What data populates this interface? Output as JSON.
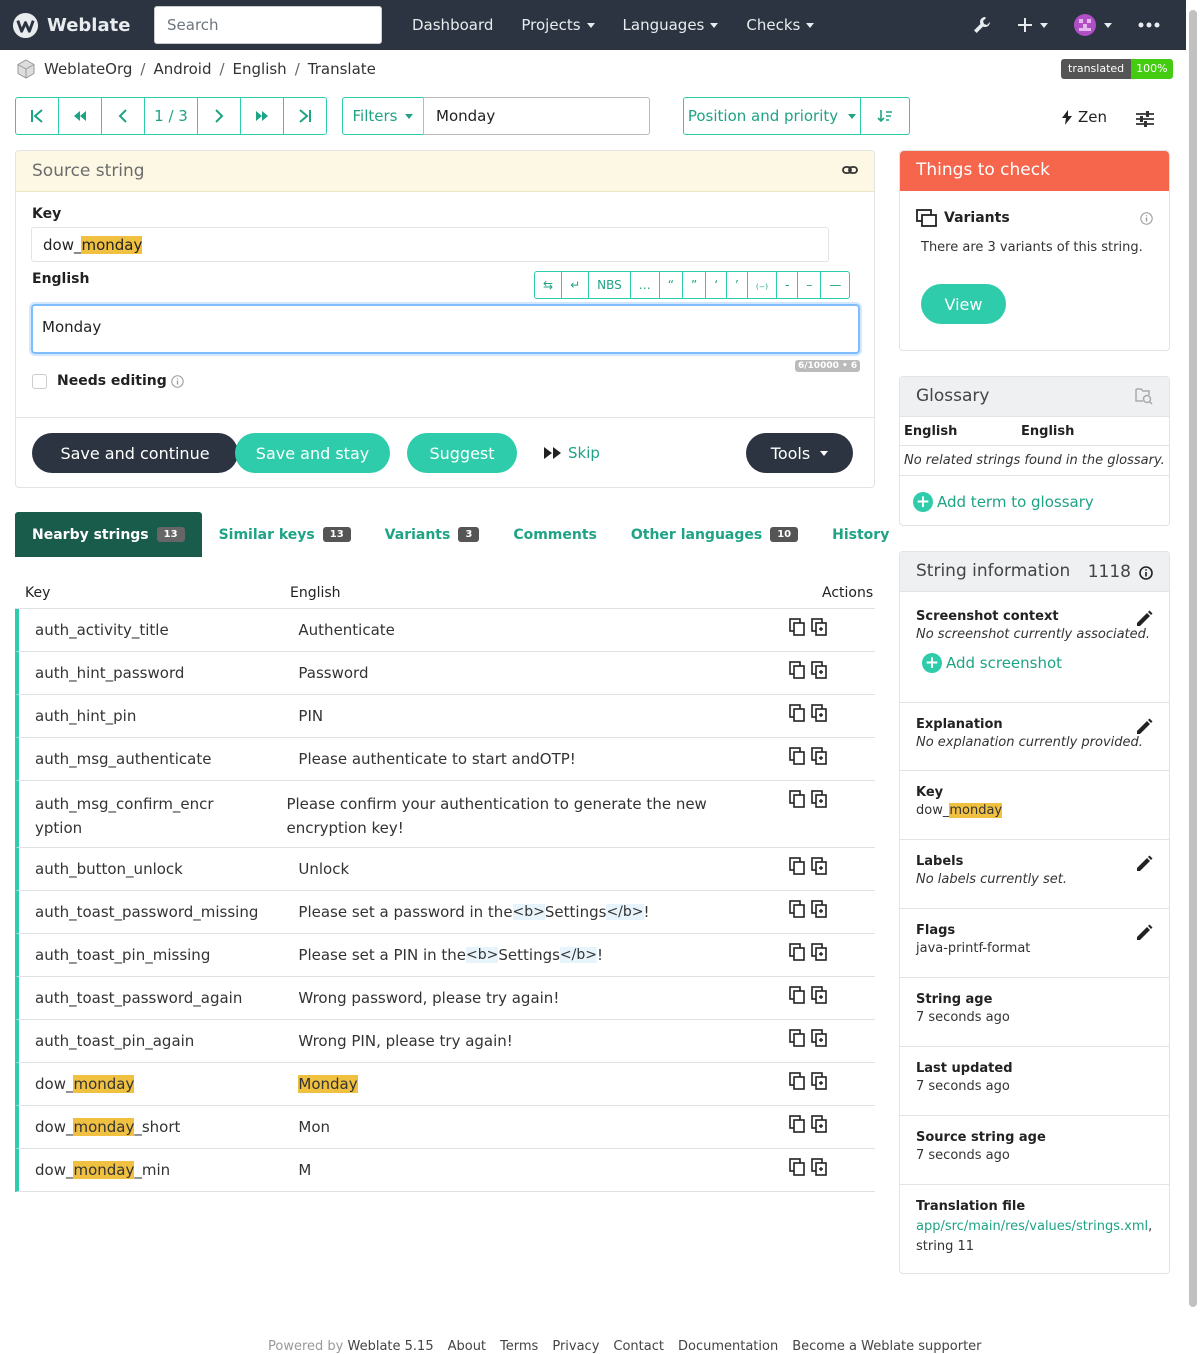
{
  "nav": {
    "brand": "Weblate",
    "search_placeholder": "Search",
    "links": [
      "Dashboard",
      "Projects",
      "Languages",
      "Checks"
    ]
  },
  "breadcrumb": [
    "WeblateOrg",
    "Android",
    "English",
    "Translate"
  ],
  "status_badge": {
    "label": "translated",
    "value": "100%"
  },
  "toolbar": {
    "position": "1 / 3",
    "filters_label": "Filters",
    "query_value": "Monday",
    "sort_label": "Position and priority",
    "zen_label": "Zen"
  },
  "source": {
    "header": "Source string",
    "key_label": "Key",
    "key_prefix": "dow_",
    "key_highlight": "monday",
    "lang_label": "English",
    "char_buttons": [
      "⇆",
      "↵",
      "NBS",
      "…",
      "“",
      "”",
      "‘",
      "’",
      "₍₋₎",
      "‐",
      "–",
      "—"
    ],
    "editor_value": "Monday",
    "counter": "6/10000 • 6",
    "needs_editing_label": "Needs editing",
    "buttons": {
      "save_continue": "Save and continue",
      "save_stay": "Save and stay",
      "suggest": "Suggest",
      "skip": "Skip",
      "tools": "Tools"
    }
  },
  "tabs": [
    {
      "label": "Nearby strings",
      "count": "13"
    },
    {
      "label": "Similar keys",
      "count": "13"
    },
    {
      "label": "Variants",
      "count": "3"
    },
    {
      "label": "Comments",
      "count": ""
    },
    {
      "label": "Other languages",
      "count": "10"
    },
    {
      "label": "History",
      "count": ""
    }
  ],
  "table": {
    "headers": [
      "Key",
      "English",
      "Actions"
    ],
    "rows": [
      {
        "k1": "auth_activity_title",
        "k2": "",
        "k3": "",
        "e1": "Authenticate",
        "e2": "",
        "e3": "",
        "e4": "",
        "e5": ""
      },
      {
        "k1": "auth_hint_password",
        "k2": "",
        "k3": "",
        "e1": "Password",
        "e2": "",
        "e3": "",
        "e4": "",
        "e5": ""
      },
      {
        "k1": "auth_hint_pin",
        "k2": "",
        "k3": "",
        "e1": "PIN",
        "e2": "",
        "e3": "",
        "e4": "",
        "e5": ""
      },
      {
        "k1": "auth_msg_authenticate",
        "k2": "",
        "k3": "",
        "e1": "Please authenticate to start andOTP!",
        "e2": "",
        "e3": "",
        "e4": "",
        "e5": ""
      },
      {
        "k1": "auth_msg_confirm_encryption",
        "k2": "",
        "k3": "",
        "e1": "Please confirm your authentication to generate the new encryption key!",
        "e2": "",
        "e3": "",
        "e4": "",
        "e5": ""
      },
      {
        "k1": "auth_button_unlock",
        "k2": "",
        "k3": "",
        "e1": "Unlock",
        "e2": "",
        "e3": "",
        "e4": "",
        "e5": ""
      },
      {
        "k1": "auth_toast_password_missing",
        "k2": "",
        "k3": "",
        "e1": "Please set a password in the ",
        "e2": "<b>",
        "e3": "Settings",
        "e4": "</b>",
        "e5": "!"
      },
      {
        "k1": "auth_toast_pin_missing",
        "k2": "",
        "k3": "",
        "e1": "Please set a PIN in the ",
        "e2": "<b>",
        "e3": "Settings",
        "e4": "</b>",
        "e5": "!"
      },
      {
        "k1": "auth_toast_password_again",
        "k2": "",
        "k3": "",
        "e1": "Wrong password, please try again!",
        "e2": "",
        "e3": "",
        "e4": "",
        "e5": ""
      },
      {
        "k1": "auth_toast_pin_again",
        "k2": "",
        "k3": "",
        "e1": "Wrong PIN, please try again!",
        "e2": "",
        "e3": "",
        "e4": "",
        "e5": ""
      },
      {
        "k1": "dow_",
        "k2": "monday",
        "k3": "",
        "e1": "",
        "e2": "",
        "e3": "",
        "e4": "",
        "e5": "",
        "e_hl": "Monday"
      },
      {
        "k1": "dow_",
        "k2": "monday",
        "k3": "_short",
        "e1": "Mon",
        "e2": "",
        "e3": "",
        "e4": "",
        "e5": ""
      },
      {
        "k1": "dow_",
        "k2": "monday",
        "k3": "_min",
        "e1": "M",
        "e2": "",
        "e3": "",
        "e4": "",
        "e5": ""
      }
    ]
  },
  "checks": {
    "header": "Things to check",
    "title": "Variants",
    "text": "There are 3 variants of this string.",
    "button": "View"
  },
  "glossary": {
    "header": "Glossary",
    "col1": "English",
    "col2": "English",
    "empty": "No related strings found in the glossary.",
    "add": "Add term to glossary"
  },
  "info": {
    "header": "String information",
    "id": "1118",
    "screenshot_title": "Screenshot context",
    "screenshot_empty": "No screenshot currently associated.",
    "screenshot_add": "Add screenshot",
    "explanation_title": "Explanation",
    "explanation_empty": "No explanation currently provided.",
    "key_title": "Key",
    "key_prefix": "dow_",
    "key_highlight": "monday",
    "labels_title": "Labels",
    "labels_empty": "No labels currently set.",
    "flags_title": "Flags",
    "flags_value": "java-printf-format",
    "age_title": "String age",
    "age_value": "7 seconds ago",
    "updated_title": "Last updated",
    "updated_value": "7 seconds ago",
    "src_age_title": "Source string age",
    "src_age_value": "7 seconds ago",
    "file_title": "Translation file",
    "file_link": "app/src/main/res/values/strings.xml",
    "file_suffix": ",",
    "file_string": "string 11"
  },
  "footer": {
    "powered": "Powered by",
    "version": "Weblate 5.15",
    "links": [
      "About",
      "Terms",
      "Privacy",
      "Contact",
      "Documentation",
      "Become a Weblate supporter"
    ]
  },
  "colors": {
    "accent": "#2eccaa",
    "navbar": "#2b3440",
    "warning": "#f6664d"
  }
}
